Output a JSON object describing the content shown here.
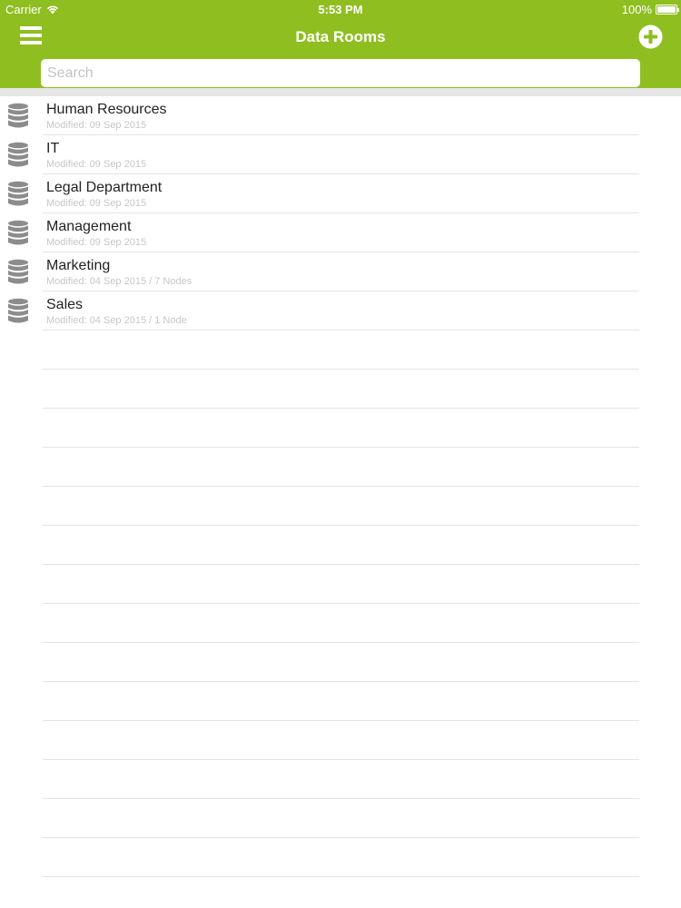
{
  "status_bar": {
    "carrier": "Carrier",
    "time": "5:53 PM",
    "battery": "100%"
  },
  "nav": {
    "title": "Data Rooms"
  },
  "search": {
    "placeholder": "Search",
    "value": ""
  },
  "colors": {
    "accent": "#8fbe21",
    "icon_gray": "#8c8c8c"
  },
  "rooms": [
    {
      "name": "Human Resources",
      "meta": "Modified: 09 Sep 2015"
    },
    {
      "name": "IT",
      "meta": "Modified: 09 Sep 2015"
    },
    {
      "name": "Legal Department",
      "meta": "Modified: 09 Sep 2015"
    },
    {
      "name": "Management",
      "meta": "Modified: 09 Sep 2015"
    },
    {
      "name": "Marketing",
      "meta": "Modified: 04 Sep 2015 /  7 Nodes"
    },
    {
      "name": "Sales",
      "meta": "Modified: 04 Sep 2015 /  1 Node"
    }
  ]
}
